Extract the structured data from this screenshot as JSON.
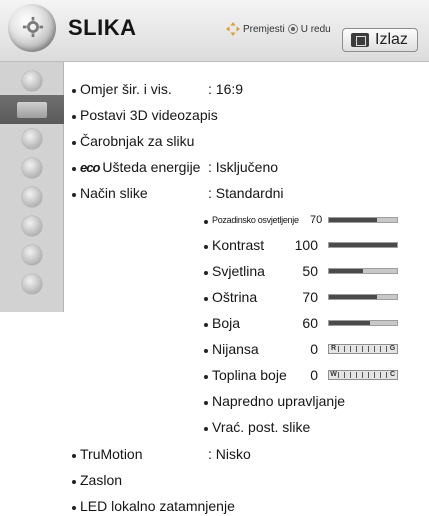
{
  "header": {
    "title": "SLIKA",
    "nav_hint_move": "Premjesti",
    "nav_hint_ok": "U redu",
    "exit_label": "Izlaz"
  },
  "sidebar": {
    "items": [
      {
        "icon": "gear-icon"
      },
      {
        "icon": "picture-icon",
        "active": true
      },
      {
        "icon": "audio-icon"
      },
      {
        "icon": "clock-icon"
      },
      {
        "icon": "lock-icon"
      },
      {
        "icon": "calendar-icon"
      },
      {
        "icon": "network-icon"
      },
      {
        "icon": "help-icon"
      }
    ]
  },
  "settings": {
    "aspect_label": "Omjer šir. i vis.",
    "aspect_value": ": 16:9",
    "video3d_label": "Postavi 3D videozapis",
    "wizard_label": "Čarobnjak za sliku",
    "eco_icon": "eco",
    "energy_label": "Ušteda energije",
    "energy_value": ": Isključeno",
    "mode_label": "Način slike",
    "mode_value": ": Standardni",
    "adjust": [
      {
        "label": "Pozadinsko osvjetljenje",
        "value": "70",
        "level": 0.7
      },
      {
        "label": "Kontrast",
        "value": "100",
        "level": 1.0
      },
      {
        "label": "Svjetlina",
        "value": "50",
        "level": 0.5
      },
      {
        "label": "Oštrina",
        "value": "70",
        "level": 0.7
      },
      {
        "label": "Boja",
        "value": "60",
        "level": 0.6
      },
      {
        "label": "Nijansa",
        "value": "0",
        "left_end": "R",
        "right_end": "G"
      },
      {
        "label": "Toplina boje",
        "value": "0",
        "left_end": "W",
        "right_end": "C"
      }
    ],
    "advanced_label": "Napredno upravljanje",
    "reset_label": "Vrać. post. slike",
    "trumotion_label": "TruMotion",
    "trumotion_value": ": Nisko",
    "screen_label": "Zaslon",
    "local_dimming_label": "LED lokalno zatamnjenje"
  },
  "colors": {
    "sidebar_bg": "#d2d2d2",
    "sidebar_active": "#5f5f5f",
    "bar_fill": "#4a4a4a"
  }
}
